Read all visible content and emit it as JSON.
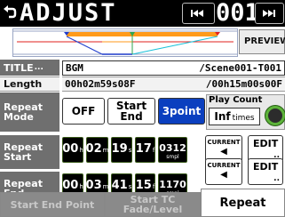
{
  "header": {
    "title": "ADJUST",
    "back_icon": "return-arrow-icon",
    "prev_icon": "skip-back-icon",
    "next_icon": "skip-forward-icon",
    "counter": "001"
  },
  "preview": {
    "label": "PREVIEW"
  },
  "colors": {
    "header_bg": "#000000",
    "label_bg": "#6f6f6f",
    "selected_mode": "#0b3fbf",
    "knob": "#5db33a",
    "marker_blue": "#1f3ccc",
    "marker_orange": "#ff9a1a",
    "marker_cyan": "#19c1d9",
    "marker_green": "#2ea64f",
    "marker_red": "#e0201e"
  },
  "info": {
    "title_label": "TITLE",
    "title_value": "BGM",
    "title_right": "/Scene001-T001",
    "length_label": "Length",
    "length_value": "00h02m59s08F",
    "length_right": "/00h15m00s00F"
  },
  "repeat_mode": {
    "label_line1": "Repeat",
    "label_line2": "Mode",
    "options": [
      "OFF",
      "Start",
      "End",
      "3point"
    ],
    "selected": "3point"
  },
  "play_count": {
    "label": "Play Count",
    "value": "Inf",
    "unit": "times",
    "knob_icon": "rotary-knob-icon"
  },
  "repeat_start": {
    "label_line1": "Repeat",
    "label_line2": "Start",
    "h": "00",
    "h_unit": "h",
    "m": "02",
    "m_unit": "m",
    "s": "19",
    "s_unit": "s",
    "f": "17",
    "f_unit": "f",
    "smpl": "0312",
    "smpl_unit": "smpl",
    "current_label": "CURRENT",
    "edit_label": "EDIT"
  },
  "repeat_end": {
    "label_line1": "Repeat",
    "label_line2": "End",
    "h": "00",
    "h_unit": "h",
    "m": "03",
    "m_unit": "m",
    "s": "41",
    "s_unit": "s",
    "f": "15",
    "f_unit": "f",
    "smpl": "1170",
    "smpl_unit": "smpl",
    "current_label": "CURRENT",
    "edit_label": "EDIT"
  },
  "tabs": [
    {
      "label": "Start End Point"
    },
    {
      "label_line1": "Start TC",
      "label_line2": "Fade/Level"
    },
    {
      "label": "Repeat"
    }
  ]
}
